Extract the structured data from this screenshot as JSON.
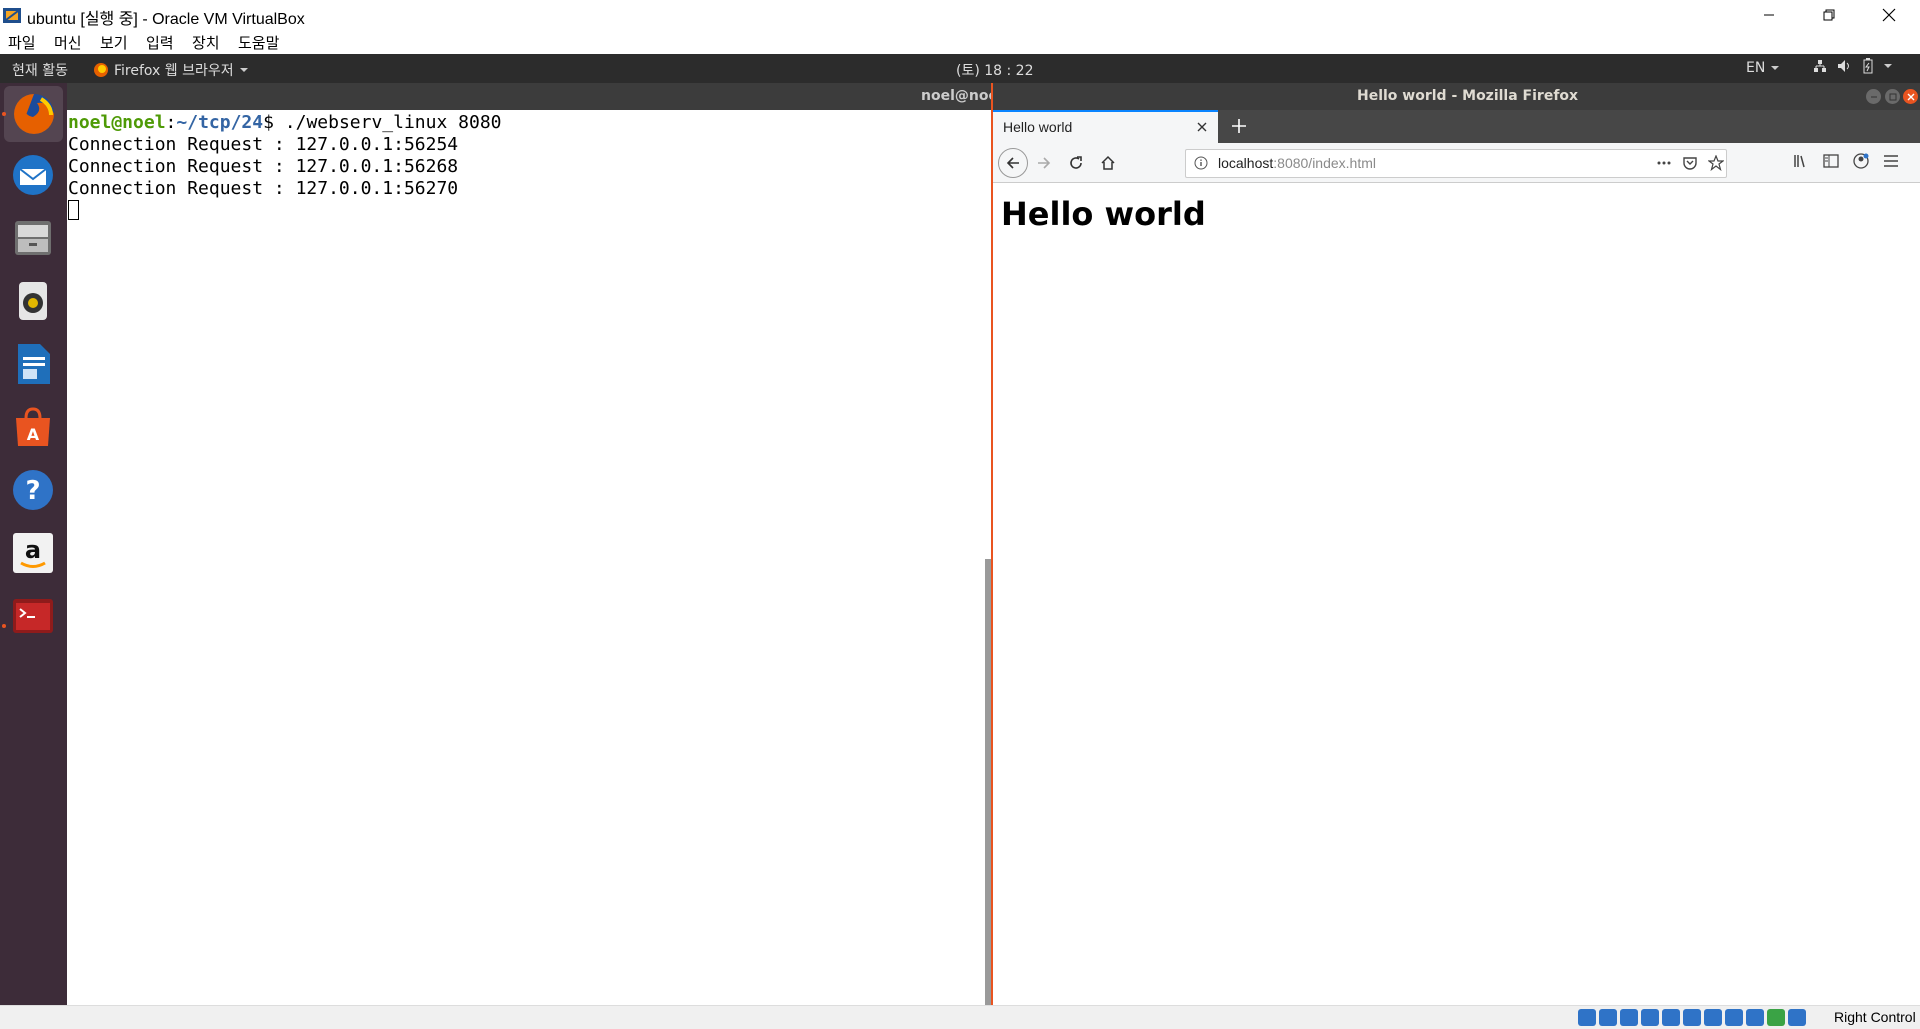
{
  "host_window": {
    "title": "ubuntu [실행 중] - Oracle VM VirtualBox",
    "menus": [
      "파일",
      "머신",
      "보기",
      "입력",
      "장치",
      "도움말"
    ],
    "host_key_label": "Right Control"
  },
  "topbar": {
    "activities": "현재 활동",
    "app_menu": "Firefox 웹 브라우저",
    "clock": "(토) 18 : 22",
    "lang": "EN"
  },
  "dock": {
    "items": [
      "firefox",
      "thunderbird",
      "files",
      "rhythmbox",
      "libreoffice-writer",
      "software-center",
      "help",
      "amazon",
      "terminal"
    ]
  },
  "terminal": {
    "title": "noel@noe",
    "prompt_user": "noel@noel",
    "prompt_sep": ":",
    "prompt_path": "~/tcp/24",
    "prompt_end": "$ ./webserv_linux 8080",
    "lines": [
      "Connection Request : 127.0.0.1:56254",
      "Connection Request : 127.0.0.1:56268",
      "Connection Request : 127.0.0.1:56270"
    ]
  },
  "firefox": {
    "window_title": "Hello world - Mozilla Firefox",
    "tab_title": "Hello world",
    "url_host": "localhost",
    "url_path": ":8080/index.html",
    "page_heading": "Hello world"
  },
  "colors": {
    "ubuntu_orange": "#e95420",
    "dock_bg": "#3d2c39",
    "topbar_bg": "#2c2c2c"
  }
}
